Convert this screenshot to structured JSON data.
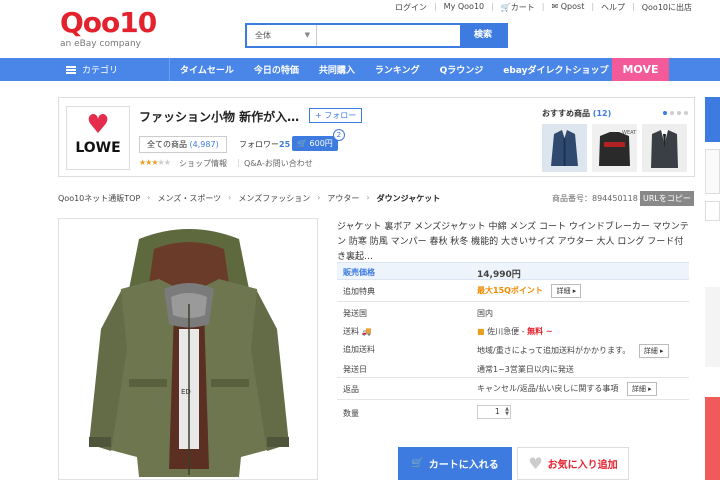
{
  "util": {
    "login": "ログイン",
    "my": "My Qoo10",
    "cart": "カート",
    "qpost": "Qpost",
    "help": "ヘルプ",
    "sell": "Qoo10に出店"
  },
  "logo": {
    "main": "Qoo10",
    "sub": "an eBay company"
  },
  "search": {
    "category": "全体",
    "placeholder": "",
    "button": "検索"
  },
  "nav": {
    "category": "カテゴリ",
    "items": [
      "タイムセール",
      "今日の特価",
      "共同購入",
      "ランキング",
      "Qラウンジ",
      "ebayダイレクトショップ"
    ],
    "move": "MOVE"
  },
  "shop": {
    "logo_name": "LOWE",
    "name": "ファッション小物 新作が入…",
    "follow_label": "+ フォロー",
    "all_products": "全ての商品",
    "product_count": "(4,987)",
    "followers_label": "フォロワー",
    "followers_count": "25",
    "coupon": "600円",
    "coupon_badge": "2",
    "info": "ショップ情報",
    "qa": "Q&A-お問い合わせ"
  },
  "reco": {
    "title": "おすすめ商品",
    "count": "(12)"
  },
  "breadcrumb": {
    "items": [
      "Qoo10ネット通販TOP",
      "メンズ・スポーツ",
      "メンズファッション",
      "アウター"
    ],
    "current": "ダウンジャケット"
  },
  "item_no": {
    "label": "商品番号：",
    "value": "894450118",
    "copy": "URLをコピー"
  },
  "product": {
    "title": "ジャケット 裏ボア メンズジャケット 中綿 メンズ コート ウインドブレーカー マウンテン 防寒 防風 マンパー 春秋 秋冬 機能的 大きいサイズ アウター 大人 ロング フード付き裏起…",
    "rows": {
      "price_label": "販売価格",
      "price": "14,990円",
      "bonus_label": "追加特典",
      "bonus": "最大15Qポイント",
      "ship_from_label": "発送国",
      "ship_from": "国内",
      "shipping_label": "送料",
      "carrier": "佐川急便 -",
      "free": "無料 ~",
      "extra_label": "追加送料",
      "extra": "地域/重さによって追加送料がかかります。",
      "dispatch_label": "発送日",
      "dispatch": "通常1~3営業日以内に発送",
      "return_label": "返品",
      "return": "キャンセル/返品/払い戻しに関する事項",
      "qty_label": "数量",
      "qty": "1",
      "detail": "詳細"
    }
  },
  "buttons": {
    "cart": "カートに入れる",
    "fav": "お気に入り追加"
  },
  "colors": {
    "brand": "#e4222e",
    "accent": "#3d7be0",
    "move": "#f25a9a"
  }
}
